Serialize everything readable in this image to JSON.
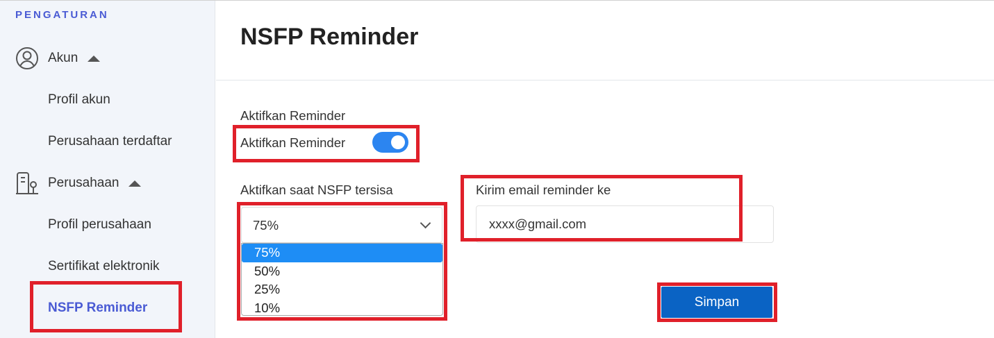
{
  "sidebar": {
    "heading": "PENGATURAN",
    "groups": [
      {
        "label": "Akun",
        "icon": "user-circle-icon",
        "items": [
          "Profil akun",
          "Perusahaan terdaftar"
        ]
      },
      {
        "label": "Perusahaan",
        "icon": "building-icon",
        "items": [
          "Profil perusahaan",
          "Sertifikat elektronik",
          "NSFP Reminder"
        ]
      }
    ],
    "active_item": "NSFP Reminder"
  },
  "main": {
    "title": "NSFP Reminder",
    "reminder": {
      "section_label": "Aktifkan Reminder",
      "toggle_label": "Aktifkan Reminder",
      "enabled": true
    },
    "threshold": {
      "label": "Aktifkan saat NSFP tersisa",
      "selected": "75%",
      "options": [
        "75%",
        "50%",
        "25%",
        "10%"
      ]
    },
    "email": {
      "label": "Kirim email reminder ke",
      "value": "xxxx@gmail.com"
    },
    "save_label": "Simpan"
  },
  "colors": {
    "accent": "#4a5bd4",
    "toggle_on": "#2c85f0",
    "option_selected": "#1e8df5",
    "primary_button": "#0a63c4",
    "highlight_box": "#e0202a",
    "sidebar_bg": "#f2f5fa"
  }
}
